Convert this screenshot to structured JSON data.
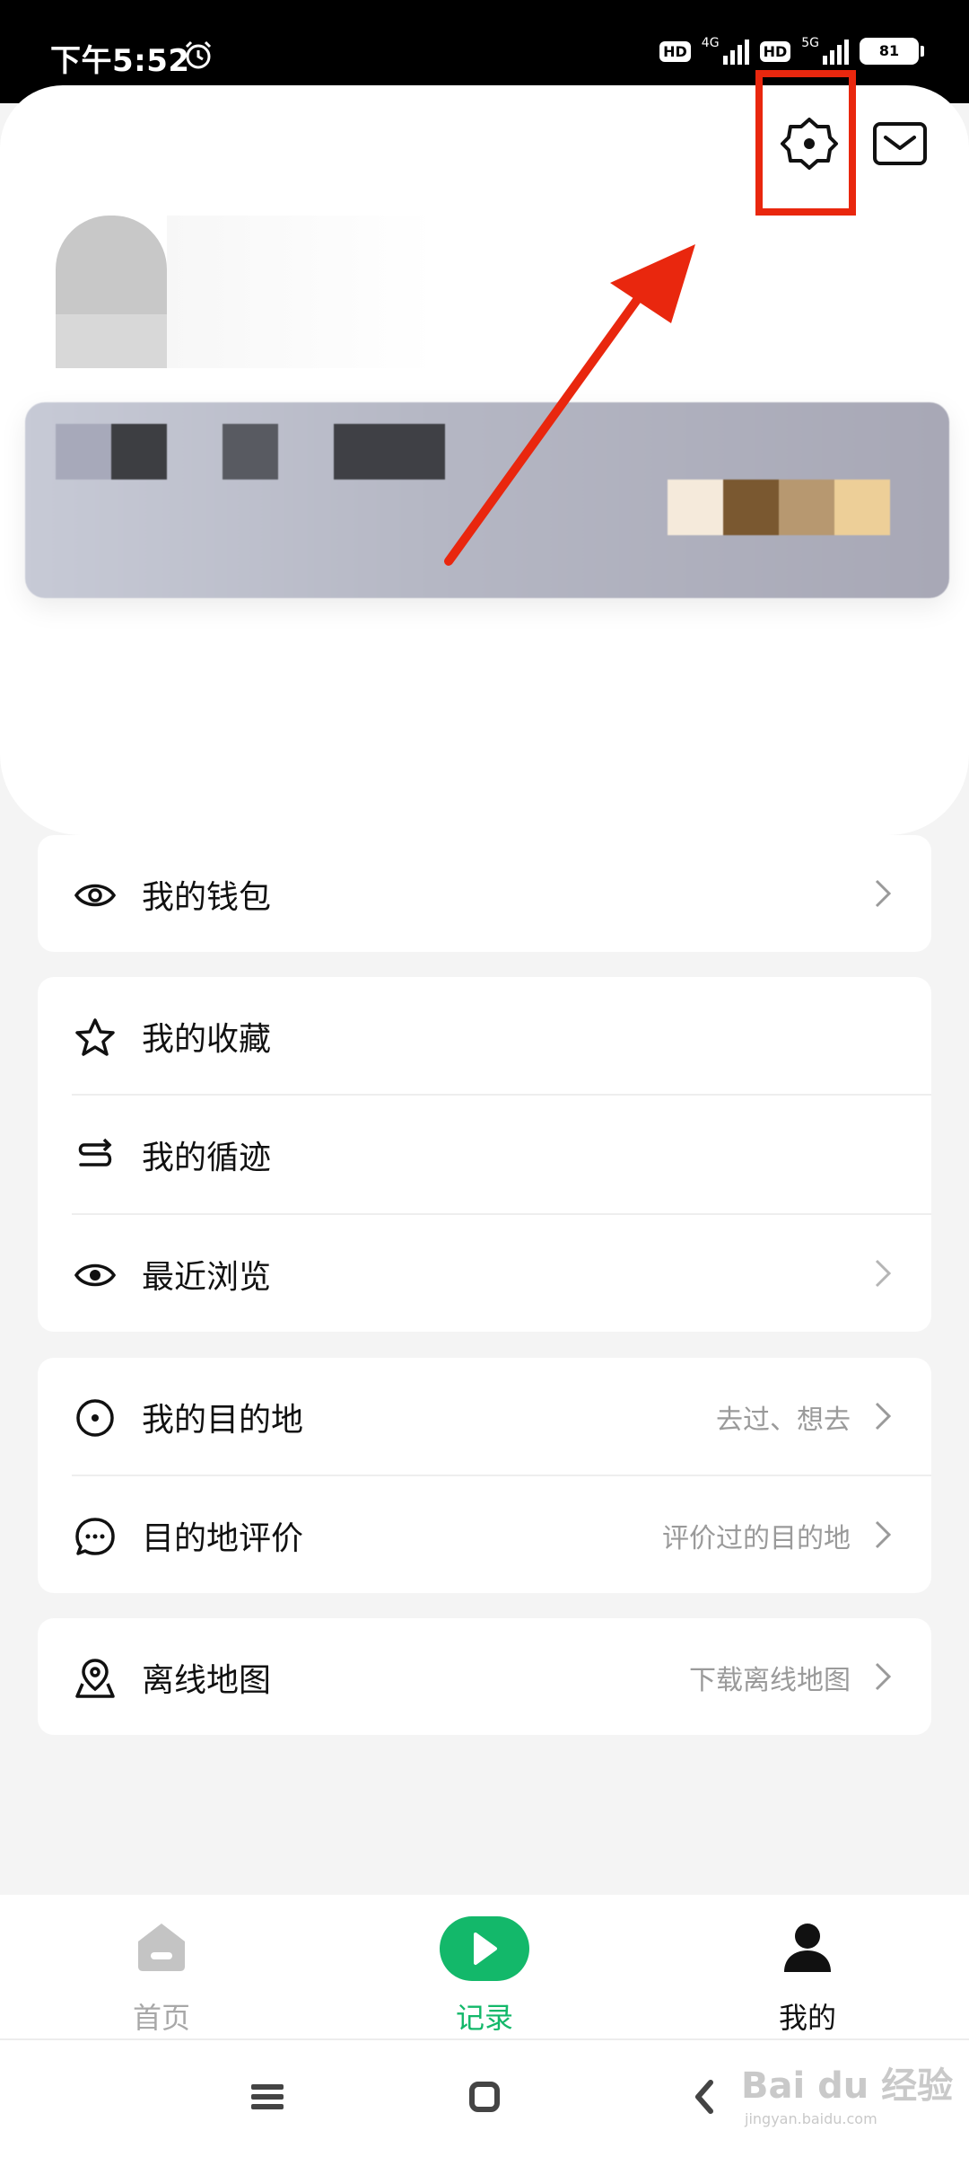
{
  "status_bar": {
    "time": "下午5:52",
    "hd_badge_1": "HD",
    "network_1": "4G",
    "hd_badge_2": "HD",
    "network_2": "5G",
    "battery": "81"
  },
  "header": {
    "settings_icon": "settings-gear-icon",
    "mail_icon": "mail-icon",
    "highlight_color": "#e9270e"
  },
  "menu": {
    "section1": [
      {
        "label": "我的钱包",
        "icon": "eye-icon",
        "sub": ""
      }
    ],
    "section2": [
      {
        "label": "我的收藏",
        "icon": "star-icon",
        "sub": ""
      },
      {
        "label": "我的循迹",
        "icon": "route-icon",
        "sub": ""
      },
      {
        "label": "最近浏览",
        "icon": "eye-icon",
        "sub": ""
      }
    ],
    "section3": [
      {
        "label": "我的目的地",
        "icon": "target-icon",
        "sub": "去过、想去"
      },
      {
        "label": "目的地评价",
        "icon": "comment-icon",
        "sub": "评价过的目的地"
      }
    ],
    "section4": [
      {
        "label": "离线地图",
        "icon": "map-pin-icon",
        "sub": "下载离线地图"
      }
    ]
  },
  "tabbar": {
    "home": "首页",
    "record": "记录",
    "mine": "我的",
    "accent": "#13b86a"
  },
  "watermark": {
    "main": "Bai du 经验",
    "sub": "jingyan.baidu.com"
  }
}
